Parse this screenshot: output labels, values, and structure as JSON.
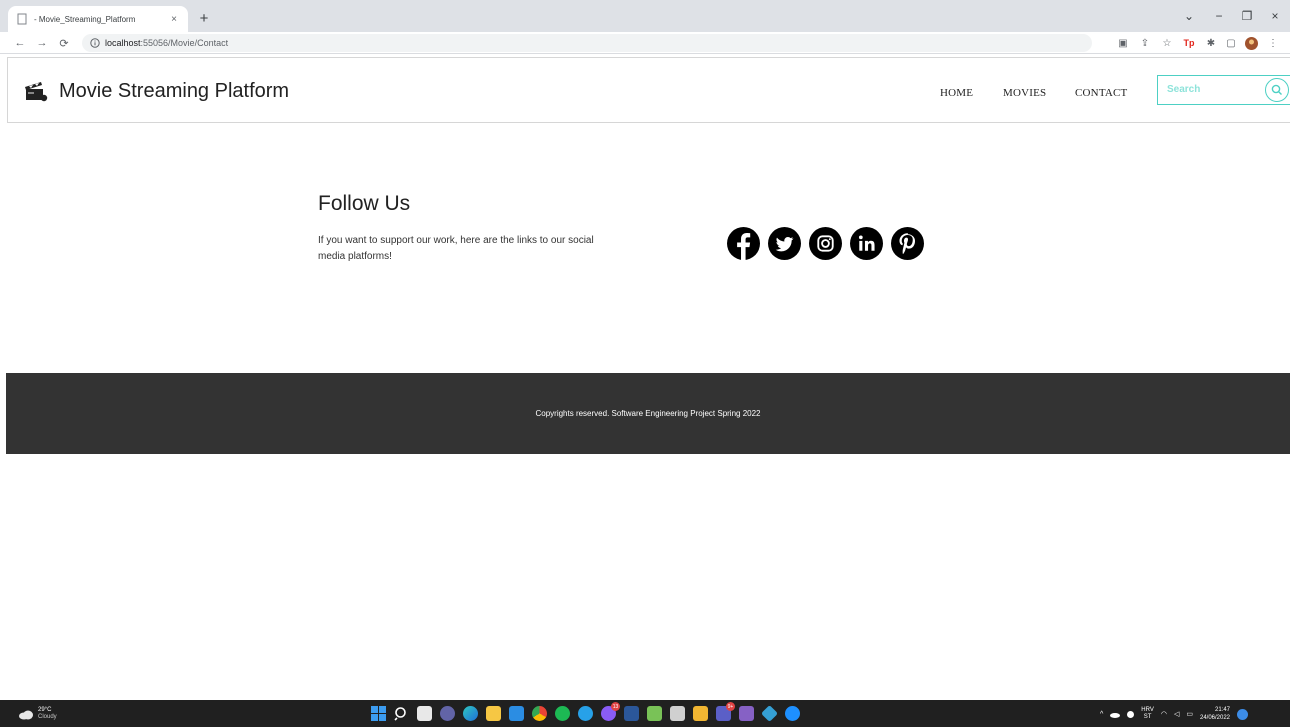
{
  "browser": {
    "tab_title": "- Movie_Streaming_Platform",
    "tab_close": "×",
    "new_tab": "+",
    "url_host": "localhost",
    "url_path": ":55056/Movie/Contact",
    "window_controls": [
      "⌄",
      "−",
      "❐",
      "×"
    ]
  },
  "header": {
    "brand": "Movie Streaming Platform",
    "nav": [
      "HOME",
      "MOVIES",
      "CONTACT"
    ],
    "search_placeholder": "Search",
    "accent_color": "#4dd0c4"
  },
  "follow": {
    "title": "Follow Us",
    "text": "If you want to support our work, here are the links to our social media platforms!",
    "social_icons": [
      "facebook-icon",
      "twitter-icon",
      "instagram-icon",
      "linkedin-icon",
      "pinterest-icon"
    ]
  },
  "footer": {
    "text": "Copyrights reserved. Software Engineering Project Spring 2022",
    "bg_color": "#333333"
  },
  "taskbar": {
    "temperature": "29°C",
    "weather": "Cloudy",
    "lang_top": "HRV",
    "lang_bottom": "ST",
    "time": "21:47",
    "date": "24/06/2022",
    "badge_1": "13",
    "badge_2": "9+"
  }
}
